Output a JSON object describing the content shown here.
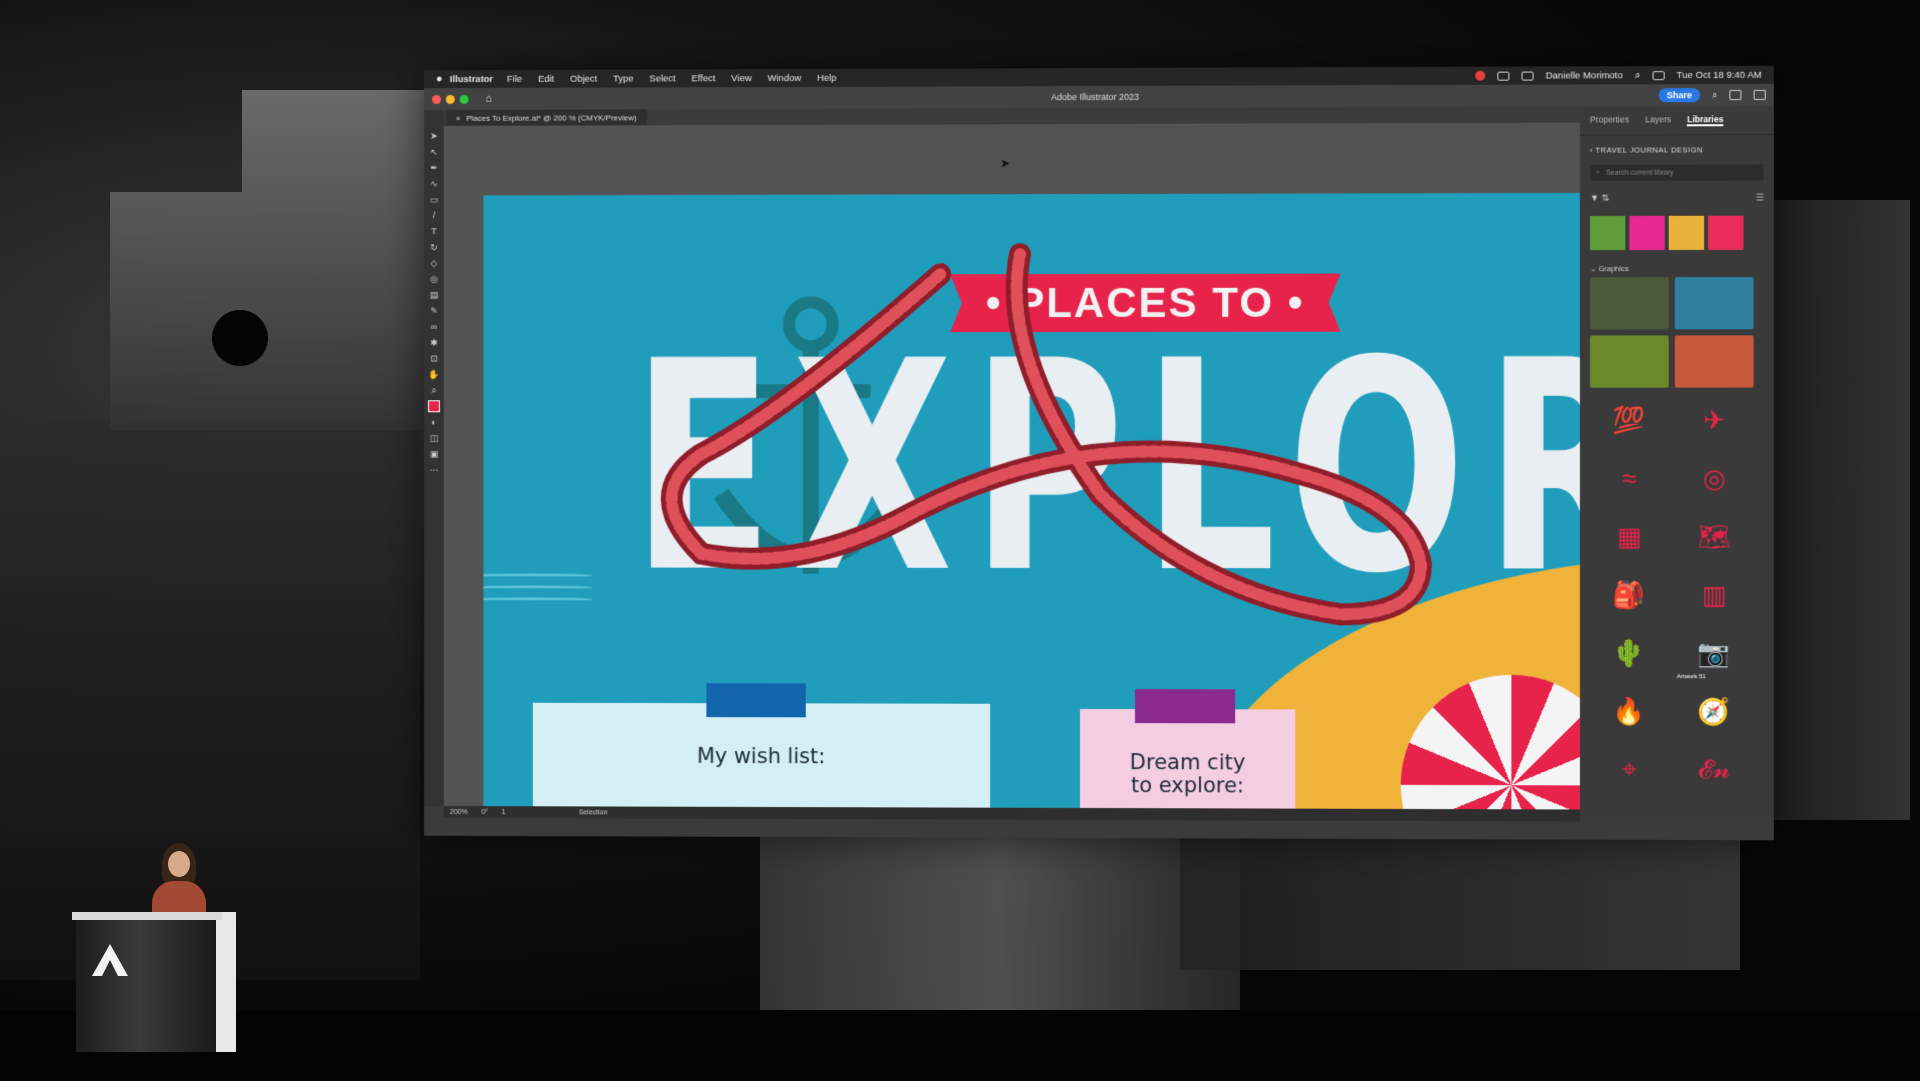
{
  "menubar": {
    "app_name": "Illustrator",
    "items": [
      "File",
      "Edit",
      "Object",
      "Type",
      "Select",
      "Effect",
      "View",
      "Window",
      "Help"
    ],
    "user_name": "Danielle Morimoto",
    "datetime": "Tue Oct 18  9:40 AM"
  },
  "window": {
    "title": "Adobe Illustrator 2023",
    "share_label": "Share",
    "document_tab": "Places To Explore.ai* @ 200 % (CMYK/Preview)"
  },
  "artwork": {
    "banner_text": "• PLACES TO •",
    "headline": "EXPLORE",
    "card_wish_label": "My wish list:",
    "card_dream_label_line1": "Dream city",
    "card_dream_label_line2": "to explore:",
    "colors": {
      "ocean": "#1f9dbb",
      "banner": "#e8234b",
      "headline": "#e9eef2",
      "sand": "#f0b33a"
    }
  },
  "statusbar": {
    "zoom": "200%",
    "rotation": "0°",
    "artboard_index": "1",
    "tool_name": "Selection"
  },
  "panel": {
    "tabs": [
      "Properties",
      "Layers",
      "Libraries"
    ],
    "library_name": "TRAVEL JOURNAL DESIGN",
    "search_placeholder": "Search current library",
    "graphics_header": "Graphics",
    "swatches": [
      "#5f9e3a",
      "#e62a8f",
      "#e9b23a",
      "#ea2c5b"
    ],
    "graphics": [
      {
        "icon": "photo-icon",
        "color": "#4a5a3a"
      },
      {
        "icon": "mountain-lake-icon",
        "color": "#2f7fa0"
      },
      {
        "icon": "forest-icon",
        "color": "#6a8a2a"
      },
      {
        "icon": "colorful-street-icon",
        "color": "#c65a3a"
      },
      {
        "icon": "hundred-emoji-icon",
        "color": "#3a3a3a"
      },
      {
        "icon": "airplane-icon",
        "color": "#3a3a3a"
      },
      {
        "icon": "wave-lines-icon",
        "color": "#3a3a3a"
      },
      {
        "icon": "life-ring-icon",
        "color": "#3a3a3a"
      },
      {
        "icon": "photo-strip-icon",
        "color": "#3a3a3a"
      },
      {
        "icon": "map-icon",
        "color": "#3a3a3a"
      },
      {
        "icon": "backpack-icon",
        "color": "#3a3a3a"
      },
      {
        "icon": "books-icon",
        "color": "#3a3a3a"
      },
      {
        "icon": "cactus-icon",
        "color": "#3a3a3a"
      },
      {
        "icon": "camera-icon",
        "color": "#3a3a3a",
        "caption": "Artwork 51"
      },
      {
        "icon": "campfire-icon",
        "color": "#3a3a3a"
      },
      {
        "icon": "compass-icon",
        "color": "#3a3a3a"
      },
      {
        "icon": "compass-pin-icon",
        "color": "#3a3a3a"
      },
      {
        "icon": "en-route-lettering-icon",
        "color": "#3a3a3a"
      }
    ]
  }
}
